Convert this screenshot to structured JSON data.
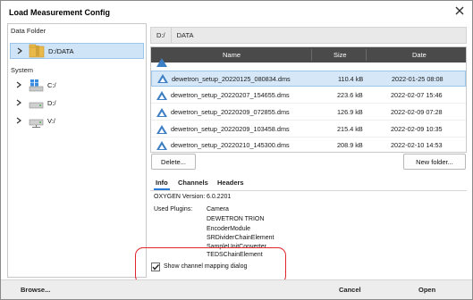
{
  "window": {
    "title": "Load Measurement Config"
  },
  "left": {
    "data_folder_label": "Data Folder",
    "data_folder_item": "D:/DATA",
    "system_label": "System",
    "drives": [
      "C:/",
      "D:/",
      "V:/"
    ]
  },
  "path_bar": {
    "crumbs": [
      "D:/",
      "DATA"
    ]
  },
  "table": {
    "columns": [
      "Name",
      "Size",
      "Date"
    ],
    "rows": [
      {
        "name": "dewetron_setup_20220125_080834.dms",
        "size": "110.4 kB",
        "date": "2022-01-25 08:08"
      },
      {
        "name": "dewetron_setup_20220207_154655.dms",
        "size": "223.6 kB",
        "date": "2022-02-07 15:46"
      },
      {
        "name": "dewetron_setup_20220209_072855.dms",
        "size": "126.9 kB",
        "date": "2022-02-09 07:28"
      },
      {
        "name": "dewetron_setup_20220209_103458.dms",
        "size": "215.4 kB",
        "date": "2022-02-09 10:35"
      },
      {
        "name": "dewetron_setup_20220210_145300.dms",
        "size": "208.9 kB",
        "date": "2022-02-10 14:53"
      }
    ]
  },
  "actions": {
    "delete_label": "Delete...",
    "new_folder_label": "New folder..."
  },
  "tabs": [
    "Info",
    "Channels",
    "Headers"
  ],
  "info": {
    "version_label": "OXYGEN Version:",
    "version_value": "6.0.2201",
    "plugins_label": "Used Plugins:",
    "plugins": [
      "Camera",
      "DEWETRON TRION",
      "EncoderModule",
      "SRDividerChainElement",
      "SampleUnitConverter",
      "TEDSChainElement"
    ]
  },
  "checkbox": {
    "label": "Show channel mapping dialog",
    "checked": true
  },
  "bottom": {
    "browse_label": "Browse...",
    "cancel_label": "Cancel",
    "open_label": "Open"
  },
  "colors": {
    "accent": "#2a7bd5",
    "highlight": "#e0262a",
    "header_bg": "#4a4a4a",
    "selection": "#d6e8f8"
  }
}
